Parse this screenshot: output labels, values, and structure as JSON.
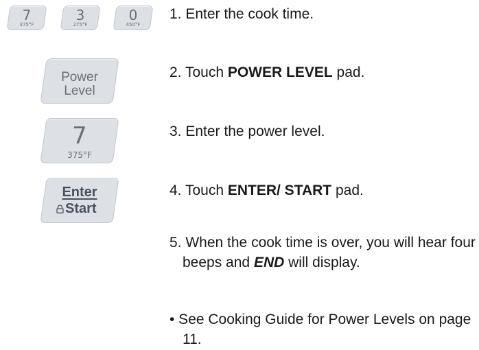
{
  "keypad": {
    "row": [
      {
        "digit": "7",
        "temp": "375°F"
      },
      {
        "digit": "3",
        "temp": "275°F"
      },
      {
        "digit": "0",
        "temp": "450°F"
      }
    ],
    "power_level": {
      "line1": "Power",
      "line2": "Level"
    },
    "seven": {
      "digit": "7",
      "temp": "375°F"
    },
    "enter_start": {
      "line1": "Enter",
      "line2": "Start"
    }
  },
  "steps": {
    "s1": {
      "text": "1. Enter the cook time."
    },
    "s2": {
      "pre": "2. Touch ",
      "bold": "POWER LEVEL",
      "post": " pad."
    },
    "s3": {
      "text": "3. Enter the power level."
    },
    "s4": {
      "pre": "4. Touch ",
      "bold": "ENTER/ START",
      "post": " pad."
    },
    "s5": {
      "pre": "5. When the cook time is over, you will hear four beeps and ",
      "bold": "END",
      "post": " will display."
    },
    "note": {
      "text": "• See Cooking Guide for Power Levels on page 11."
    }
  }
}
